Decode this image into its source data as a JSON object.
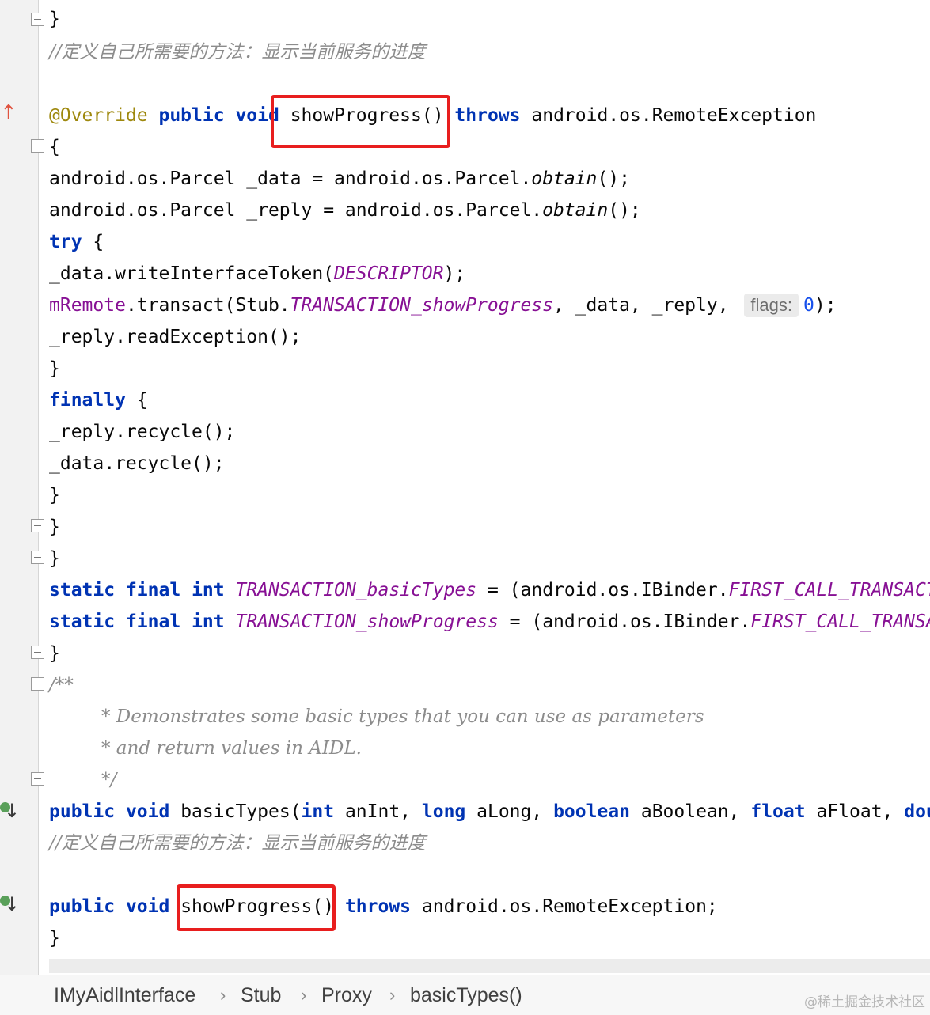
{
  "code": {
    "comment_cn": "//定义自己所需要的方法：显示当前服务的进度",
    "override": "@Override",
    "kw_public": "public",
    "kw_void": "void",
    "kw_throws": "throws",
    "kw_try": "try",
    "kw_finally": "finally",
    "kw_static": "static",
    "kw_final": "final",
    "kw_int": "int",
    "kw_long": "long",
    "kw_boolean": "boolean",
    "kw_float": "float",
    "kw_doubl": "doubl",
    "showProgress_call": "showProgress()",
    "remote_exception": "android.os.RemoteException",
    "remote_exception_semi": "android.os.RemoteException;",
    "open_brace": "{",
    "close_brace": "}",
    "parcel_type": "android.os.Parcel",
    "data_var": "_data = android.os.Parcel.",
    "reply_var": "_reply = android.os.Parcel.",
    "obtain": "obtain",
    "paren_semi": "();",
    "write_token": "_data.writeInterfaceToken(",
    "descriptor": "DESCRIPTOR",
    "close_semi": ");",
    "mremote": "mRemote",
    "transact": ".transact(Stub.",
    "transaction_show": "TRANSACTION_showProgress",
    "transact_args": ", _data, _reply, ",
    "flags_hint": "flags:",
    "zero": "0",
    "read_exception": "_reply.readException();",
    "reply_recycle": "_reply.recycle();",
    "data_recycle": "_data.recycle();",
    "transaction_basic": "TRANSACTION_basicTypes",
    "eq_binder": " = (android.os.IBinder.",
    "first_call_1": "FIRST_CALL_TRANSACTI",
    "first_call_2": "FIRST_CALL_TRANSAC",
    "doc_open": "/**",
    "doc_1": "* Demonstrates some basic types that you can use as parameters",
    "doc_2": "* and return values in AIDL.",
    "doc_close": "*/",
    "basic_types": "basicTypes(",
    "an_int": "anInt, ",
    "a_long": "aLong, ",
    "a_boolean": "aBoolean, ",
    "a_float": "aFloat, "
  },
  "breadcrumb": {
    "items": [
      "IMyAidlInterface",
      "Stub",
      "Proxy",
      "basicTypes()"
    ],
    "separator": "›"
  },
  "watermark": "@稀土掘金技术社区",
  "colors": {
    "keyword": "#0033b3",
    "annotation": "#9e880d",
    "comment": "#8c8c8c",
    "static_field": "#871094",
    "highlight_box": "#e81e1e"
  }
}
